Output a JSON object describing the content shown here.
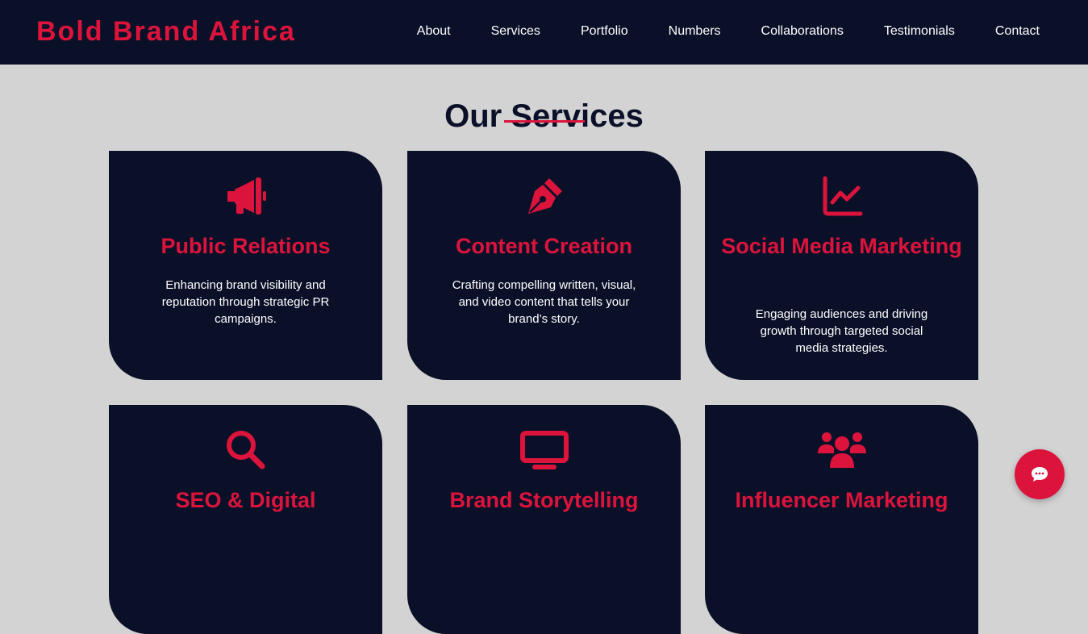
{
  "brand": "Bold Brand Africa",
  "nav": [
    "About",
    "Services",
    "Portfolio",
    "Numbers",
    "Collaborations",
    "Testimonials",
    "Contact"
  ],
  "section_title": "Our Services",
  "colors": {
    "accent": "#dc143c",
    "navy": "#0b1029",
    "background": "#d3d3d3"
  },
  "services": [
    {
      "icon": "megaphone-icon",
      "title": "Public Relations",
      "desc": "Enhancing brand visibility and reputation through strategic PR campaigns."
    },
    {
      "icon": "pen-nib-icon",
      "title": "Content Creation",
      "desc": "Crafting compelling written, visual, and video content that tells your brand’s story."
    },
    {
      "icon": "line-chart-icon",
      "title": "Social Media Marketing",
      "desc": "Engaging audiences and driving growth through targeted social media strategies."
    },
    {
      "icon": "search-icon",
      "title": "SEO & Digital",
      "desc": ""
    },
    {
      "icon": "monitor-icon",
      "title": "Brand Storytelling",
      "desc": ""
    },
    {
      "icon": "users-icon",
      "title": "Influencer Marketing",
      "desc": ""
    }
  ],
  "chat": {
    "icon": "chat-bubble-icon"
  }
}
